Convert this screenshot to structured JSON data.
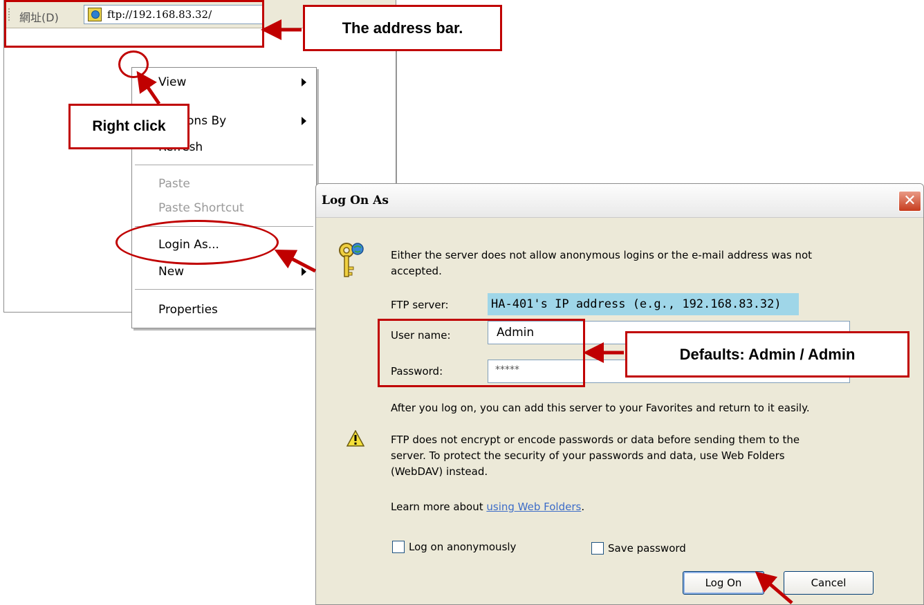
{
  "explorer": {
    "address_label": "網址(D)",
    "address_value": "ftp://192.168.83.32/"
  },
  "context_menu": {
    "items": [
      {
        "label": "View"
      },
      {
        "label": "ge Icons By"
      },
      {
        "label": "Refresh"
      },
      {
        "label": "Paste"
      },
      {
        "label": "Paste Shortcut"
      },
      {
        "label": "Login As..."
      },
      {
        "label": "New"
      },
      {
        "label": "Properties"
      }
    ]
  },
  "dialog": {
    "title": "Log On As",
    "close_glyph": "✕",
    "intro_line1": "Either the server does not allow anonymous logins or the e-mail address was not",
    "intro_line2": "accepted.",
    "ftp_server_label": "FTP server:",
    "ftp_server_value": "HA-401's IP address (e.g., 192.168.83.32)",
    "user_name_label": "User name:",
    "user_name_value": "Admin",
    "password_label": "Password:",
    "password_value": "*****",
    "favorites_text": "After you log on, you can add this server to your Favorites and return to it easily.",
    "warning_line1": "FTP does not encrypt or encode passwords or data before sending them to the",
    "warning_line2": "server.  To protect the security of your passwords and data, use Web Folders",
    "warning_line3": "(WebDAV) instead.",
    "learn_more_prefix": "Learn more about ",
    "learn_more_link": "using Web Folders",
    "learn_more_suffix": ".",
    "anonymous_label": "Log on anonymously",
    "save_password_label": "Save password",
    "log_on_button": "Log On",
    "cancel_button": "Cancel"
  },
  "annotations": {
    "address_bar": "The address bar.",
    "right_click": "Right click",
    "defaults": "Defaults: Admin / Admin"
  },
  "colors": {
    "annotation_red": "#c00000",
    "server_highlight": "#9fd6e8",
    "link_blue": "#3c6cc8"
  }
}
